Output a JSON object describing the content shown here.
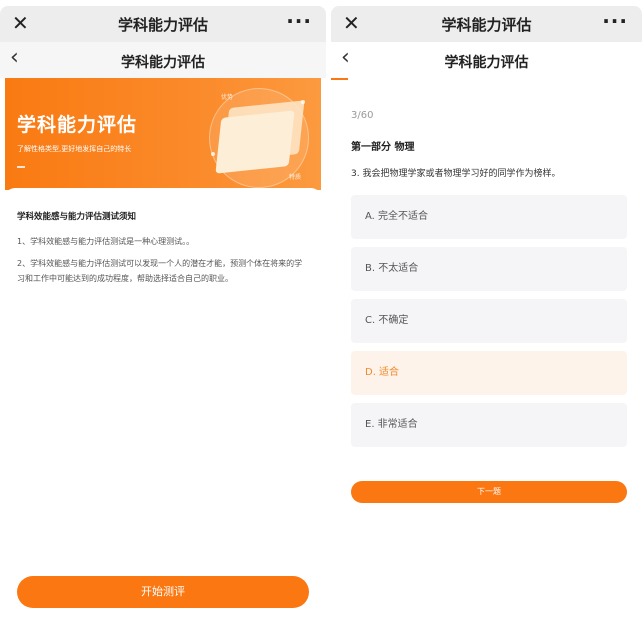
{
  "left": {
    "window_title": "学科能力评估",
    "page_title": "学科能力评估",
    "banner": {
      "title": "学科能力评估",
      "subtitle": "了解性格类型,更好地发挥自己的特长",
      "tag_top": "优势",
      "tag_bottom": "特质"
    },
    "notice": {
      "title": "学科效能感与能力评估测试须知",
      "items": [
        "1、学科效能感与能力评估测试是一种心理测试。。",
        "2、学科效能感与能力评估测试可以发现一个人的潜在才能，预测个体在将来的学习和工作中可能达到的成功程度，帮助选择适合自己的职业。"
      ]
    },
    "start_button": "开始测评"
  },
  "right": {
    "window_title": "学科能力评估",
    "page_title": "学科能力评估",
    "progress": {
      "current": 3,
      "total": 60,
      "label": "3/60"
    },
    "section": "第一部分 物理",
    "question": "3. 我会把物理学家或者物理学习好的同学作为榜样。",
    "options": [
      {
        "label": "A. 完全不适合",
        "selected": false
      },
      {
        "label": "B. 不太适合",
        "selected": false
      },
      {
        "label": "C. 不确定",
        "selected": false
      },
      {
        "label": "D. 适合",
        "selected": true
      },
      {
        "label": "E. 非常适合",
        "selected": false
      }
    ],
    "next_button": "下一题"
  },
  "icons": {
    "close": "close-icon",
    "more": "more-icon",
    "back": "back-arrow-icon"
  },
  "colors": {
    "accent": "#fa7712",
    "selected_bg": "#fdf3ea",
    "selected_text": "#f08a2a",
    "option_bg": "#f5f4f7"
  }
}
